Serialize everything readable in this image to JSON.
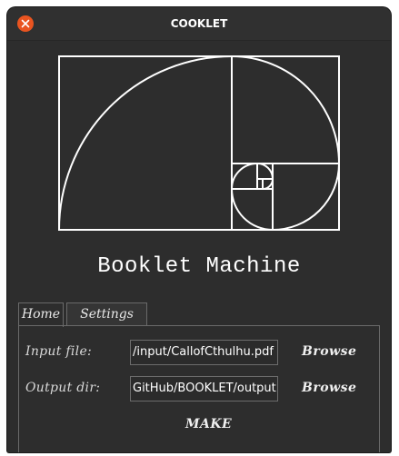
{
  "window": {
    "title": "COOKLET"
  },
  "app": {
    "heading": "Booklet Machine"
  },
  "tabs": [
    {
      "label": "Home",
      "active": true
    },
    {
      "label": "Settings",
      "active": false
    }
  ],
  "form": {
    "input_label": "Input file:",
    "input_value": "/input/CallofCthulhu.pdf",
    "input_browse": "Browse",
    "output_label": "Output dir:",
    "output_value": "GitHub/BOOKLET/output",
    "output_browse": "Browse",
    "make_label": "MAKE"
  },
  "colors": {
    "window_bg": "#2d2d2d",
    "close_button": "#e95420",
    "text": "#ffffff",
    "border": "#6a6a6a"
  },
  "icons": {
    "close": "close-icon",
    "logo": "golden-spiral-icon"
  }
}
